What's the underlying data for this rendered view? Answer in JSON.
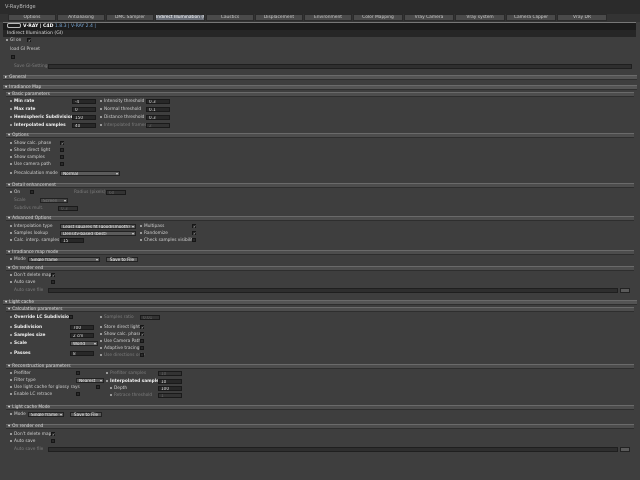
{
  "window_title": "V-RayBridge",
  "tabs": [
    "Options",
    "Antialiasing",
    "DMC Sampler",
    "Indirect Illumination (GI)",
    "Caustics",
    "Displacement",
    "Environment",
    "Color Mapping",
    "Vray Camera",
    "Vray system",
    "Camera Clipper",
    "Vray DR"
  ],
  "brand": {
    "name": "V·RAY",
    "product": "| C4D",
    "version": "1.8.3 | V-RAY 2.4 |"
  },
  "subtitle": "Indirect Illumination (GI)",
  "gi_on": {
    "label": "GI on",
    "checked": true
  },
  "load_preset": {
    "label": "load GI Preset",
    "checked": false
  },
  "save_settings_label": "Save GI-Settings",
  "general_label": "General",
  "irradiance_map": {
    "title": "Irradiance Map",
    "basic": {
      "title": "Basic parameters",
      "min_rate": {
        "label": "Min rate",
        "value": "-4"
      },
      "max_rate": {
        "label": "Max rate",
        "value": "0"
      },
      "hsph": {
        "label": "Hemispheric Subdivision",
        "value": "150"
      },
      "interp": {
        "label": "Interpolated samples",
        "value": "40"
      },
      "intensity": {
        "label": "Intensity threshold",
        "value": "0.3"
      },
      "normal": {
        "label": "Normal threshold",
        "value": "0.1"
      },
      "distance": {
        "label": "Distance threshold",
        "value": "0.3"
      },
      "interp_frames": {
        "label": "Interpolated frames",
        "value": "2"
      }
    },
    "options": {
      "title": "Options",
      "show_calc": {
        "label": "Show calc. phase",
        "checked": true
      },
      "show_direct": {
        "label": "Show direct light",
        "checked": false
      },
      "show_samples": {
        "label": "Show samples",
        "checked": false
      },
      "use_camera_path": {
        "label": "Use camera path",
        "checked": false
      },
      "precalc_mode": {
        "label": "Precalculation mode",
        "value": "Normal"
      }
    },
    "detail": {
      "title": "Detail enhancement",
      "on": {
        "label": "On",
        "checked": false
      },
      "scale": {
        "label": "Scale",
        "value": "Screen"
      },
      "radius": {
        "label": "Radius (pixels)",
        "value": "60"
      },
      "subdivs_mult": {
        "label": "Subdivs mult.",
        "value": "0.3"
      }
    },
    "advanced": {
      "title": "Advanced Options",
      "interp_type": {
        "label": "Interpolation type",
        "value": "Least squares fit (good/smooth)"
      },
      "sample_lookup": {
        "label": "Samples lookup",
        "value": "Density-based (best)"
      },
      "calc_interp": {
        "label": "Calc. interp. samples",
        "value": "15"
      },
      "multipass": {
        "label": "Multipass",
        "checked": true
      },
      "randomize": {
        "label": "Randomize",
        "checked": true
      },
      "check_vis": {
        "label": "Check samples visibility",
        "checked": false
      }
    },
    "mode_section": {
      "title": "Irradiance map mode",
      "mode": {
        "label": "Mode",
        "value": "Single frame"
      },
      "save_btn": "Save to File"
    },
    "on_render_end": {
      "title": "On render end",
      "dont_delete": {
        "label": "Don't delete map",
        "checked": true
      },
      "auto_save": {
        "label": "Auto save",
        "checked": false
      },
      "auto_save_file": "Auto save file"
    }
  },
  "light_cache": {
    "title": "Light cache",
    "calc": {
      "title": "Calculation parameters",
      "override": {
        "label": "Override LC Subdivision",
        "checked": false
      },
      "subdivision": {
        "label": "Subdivision",
        "value": "700"
      },
      "sample_size": {
        "label": "Samples size",
        "value": "2 cm"
      },
      "scale": {
        "label": "Scale",
        "value": "World"
      },
      "passes": {
        "label": "Passes",
        "value": "8"
      },
      "samples_ratio": {
        "label": "Samples ratio",
        "value": "0.01"
      },
      "store_direct": {
        "label": "Store direct light",
        "checked": true
      },
      "show_calc": {
        "label": "Show calc. phase",
        "checked": true
      },
      "camera_path": {
        "label": "Use Camera Path",
        "checked": false
      },
      "adaptive": {
        "label": "Adaptive tracing",
        "checked": false
      },
      "directions_only": {
        "label": "Use directions only",
        "checked": false
      }
    },
    "recon": {
      "title": "Reconstruction parameters",
      "prefilter": {
        "label": "Prefilter",
        "checked": false
      },
      "filter_type": {
        "label": "Filter type",
        "value": "Nearest"
      },
      "use_glossy": {
        "label": "Use light cache for glossy rays",
        "checked": false
      },
      "enable_retrace": {
        "label": "Enable LC retrace",
        "checked": false
      },
      "prefilter_samples": {
        "label": "Prefilter samples",
        "value": "10"
      },
      "interp_samples": {
        "label": "Interpolated samples",
        "value": "10"
      },
      "depth": {
        "label": "Depth",
        "value": "100"
      },
      "retrace_threshold": {
        "label": "Retrace threshold",
        "value": "1"
      }
    },
    "mode_section": {
      "title": "Light cache Mode",
      "mode": {
        "label": "Mode",
        "value": "Single frame"
      },
      "save_btn": "Save to File"
    },
    "on_render_end": {
      "title": "On render end",
      "dont_delete": {
        "label": "Don't delete map",
        "checked": true
      },
      "auto_save": {
        "label": "Auto save",
        "checked": false
      },
      "auto_save_file": "Auto save file"
    }
  }
}
